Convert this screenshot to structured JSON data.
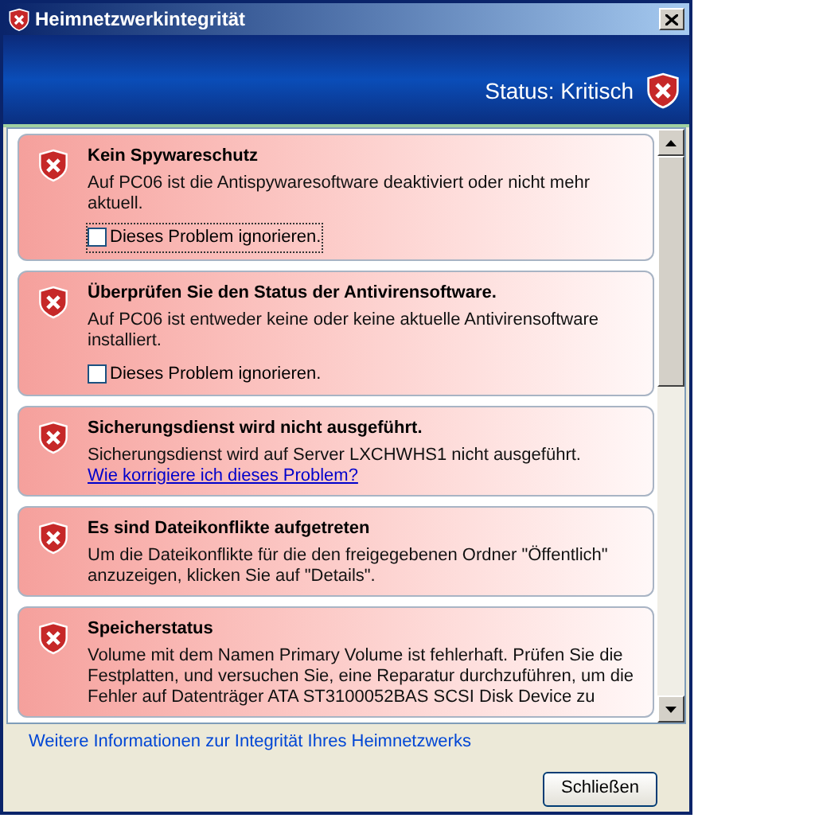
{
  "window": {
    "title": "Heimnetzwerkintegrität"
  },
  "banner": {
    "status": "Status: Kritisch"
  },
  "issues": [
    {
      "title": "Kein Spywareschutz",
      "body": "Auf PC06 ist die Antispywaresoftware deaktiviert oder nicht mehr aktuell.",
      "ignore": {
        "label": "Dieses Problem ignorieren.",
        "checked": false,
        "focused": true
      }
    },
    {
      "title": "Überprüfen Sie den Status der Antivirensoftware.",
      "body": "Auf PC06 ist entweder keine oder keine aktuelle Antivirensoftware installiert.",
      "ignore": {
        "label": "Dieses Problem ignorieren.",
        "checked": false,
        "focused": false
      }
    },
    {
      "title": "Sicherungsdienst wird nicht ausgeführt.",
      "body": "Sicherungsdienst wird auf Server LXCHWHS1 nicht ausgeführt.",
      "link": "Wie korrigiere ich dieses Problem?"
    },
    {
      "title": "Es sind Dateikonflikte aufgetreten",
      "body": "Um die Dateikonflikte für die den freigegebenen Ordner \"Öffentlich\" anzuzeigen, klicken Sie auf \"Details\"."
    },
    {
      "title": "Speicherstatus",
      "body": "Volume mit dem Namen Primary Volume ist fehlerhaft. Prüfen Sie die Festplatten, und versuchen Sie, eine Reparatur durchzuführen, um die Fehler auf Datenträger ATA ST3100052BAS SCSI Disk Device zu"
    }
  ],
  "footer_link": "Weitere Informationen zur Integrität Ihres Heimnetzwerks",
  "buttons": [
    "Schließen"
  ]
}
